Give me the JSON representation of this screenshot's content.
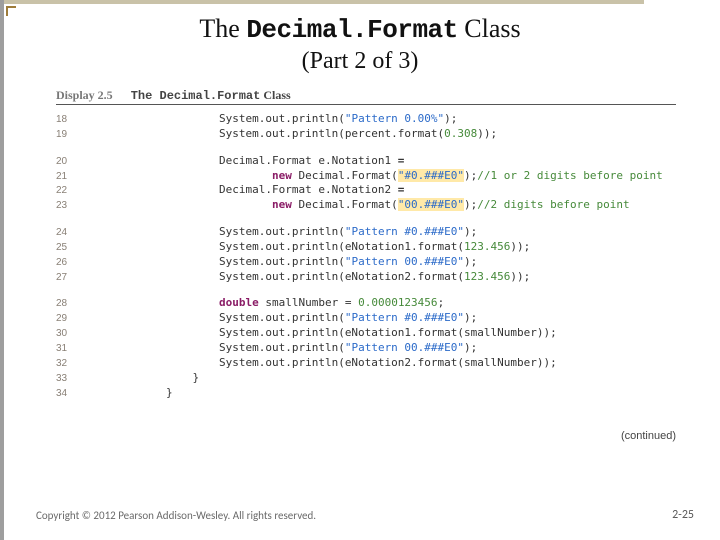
{
  "title": {
    "prefix": "The ",
    "classname": "Decimal.Format",
    "suffix": " Class",
    "subtitle": "(Part 2 of 3)"
  },
  "display": {
    "label": "Display 2.5",
    "classname": "The Decimal.Format",
    "suffix": " Class"
  },
  "code": {
    "lines": [
      {
        "n": "18",
        "indent": 2,
        "segs": [
          {
            "t": "System.out.println("
          },
          {
            "t": "\"Pattern 0.00%\"",
            "c": "tok-str"
          },
          {
            "t": ");"
          }
        ]
      },
      {
        "n": "19",
        "indent": 2,
        "segs": [
          {
            "t": "System.out.println(percent.format("
          },
          {
            "t": "0.308",
            "c": "tok-num"
          },
          {
            "t": "));"
          }
        ]
      },
      {
        "blank": true
      },
      {
        "n": "20",
        "indent": 2,
        "segs": [
          {
            "t": "Decimal.Format e.Notation1 ",
            "c": "tok-ty"
          },
          {
            "t": "=",
            "c": "tok-op"
          }
        ]
      },
      {
        "n": "21",
        "indent": 4,
        "segs": [
          {
            "t": "new",
            "c": "tok-kw"
          },
          {
            "t": " Decimal.Format("
          },
          {
            "t": "\"#0.###E0\"",
            "c": "tok-hi"
          },
          {
            "t": ");"
          },
          {
            "t": "//1 or 2 digits before point",
            "c": "tok-cm"
          }
        ]
      },
      {
        "n": "22",
        "indent": 2,
        "segs": [
          {
            "t": "Decimal.Format e.Notation2 ",
            "c": "tok-ty"
          },
          {
            "t": "=",
            "c": "tok-op"
          }
        ]
      },
      {
        "n": "23",
        "indent": 4,
        "segs": [
          {
            "t": "new",
            "c": "tok-kw"
          },
          {
            "t": " Decimal.Format("
          },
          {
            "t": "\"00.###E0\"",
            "c": "tok-hi"
          },
          {
            "t": ");"
          },
          {
            "t": "//2 digits before point",
            "c": "tok-cm"
          }
        ]
      },
      {
        "blank": true
      },
      {
        "n": "24",
        "indent": 2,
        "segs": [
          {
            "t": "System.out.println("
          },
          {
            "t": "\"Pattern #0.###E0\"",
            "c": "tok-str"
          },
          {
            "t": ");"
          }
        ]
      },
      {
        "n": "25",
        "indent": 2,
        "segs": [
          {
            "t": "System.out.println(eNotation1.format("
          },
          {
            "t": "123.456",
            "c": "tok-num"
          },
          {
            "t": "));"
          }
        ]
      },
      {
        "n": "26",
        "indent": 2,
        "segs": [
          {
            "t": "System.out.println("
          },
          {
            "t": "\"Pattern 00.###E0\"",
            "c": "tok-str"
          },
          {
            "t": ");"
          }
        ]
      },
      {
        "n": "27",
        "indent": 2,
        "segs": [
          {
            "t": "System.out.println(eNotation2.format("
          },
          {
            "t": "123.456",
            "c": "tok-num"
          },
          {
            "t": "));"
          }
        ]
      },
      {
        "blank": true
      },
      {
        "n": "28",
        "indent": 2,
        "segs": [
          {
            "t": "double",
            "c": "tok-kw"
          },
          {
            "t": " smallNumber = "
          },
          {
            "t": "0.0000123456",
            "c": "tok-num"
          },
          {
            "t": ";"
          }
        ]
      },
      {
        "n": "29",
        "indent": 2,
        "segs": [
          {
            "t": "System.out.println("
          },
          {
            "t": "\"Pattern #0.###E0\"",
            "c": "tok-str"
          },
          {
            "t": ");"
          }
        ]
      },
      {
        "n": "30",
        "indent": 2,
        "segs": [
          {
            "t": "System.out.println(eNotation1.format(smallNumber));"
          }
        ]
      },
      {
        "n": "31",
        "indent": 2,
        "segs": [
          {
            "t": "System.out.println("
          },
          {
            "t": "\"Pattern 00.###E0\"",
            "c": "tok-str"
          },
          {
            "t": ");"
          }
        ]
      },
      {
        "n": "32",
        "indent": 2,
        "segs": [
          {
            "t": "System.out.println(eNotation2.format(smallNumber));"
          }
        ]
      },
      {
        "n": "33",
        "indent": 1,
        "segs": [
          {
            "t": "}"
          }
        ]
      },
      {
        "n": "34",
        "indent": 0,
        "segs": [
          {
            "t": "}"
          }
        ]
      }
    ]
  },
  "continued": "(continued)",
  "footer": "Copyright © 2012 Pearson Addison-Wesley. All rights reserved.",
  "pagenum": "2-25"
}
